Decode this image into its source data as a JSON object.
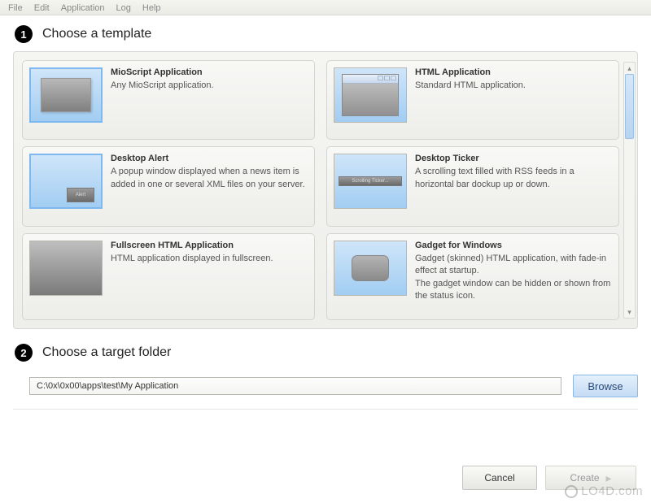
{
  "menu": {
    "items": [
      "File",
      "Edit",
      "Application",
      "Log",
      "Help"
    ]
  },
  "steps": {
    "template": {
      "num": "1",
      "title": "Choose a template"
    },
    "folder": {
      "num": "2",
      "title": "Choose a target folder"
    }
  },
  "templates": [
    {
      "title": "MioScript Application",
      "desc": "Any MioScript application.",
      "thumb": "mioscript",
      "selected": true
    },
    {
      "title": "HTML Application",
      "desc": "Standard HTML application.",
      "thumb": "html"
    },
    {
      "title": "Desktop Alert",
      "desc": "A popup window displayed when a news item is added in one or several XML files on your server.",
      "thumb": "alert",
      "alert_label": "Alert"
    },
    {
      "title": "Desktop Ticker",
      "desc": "A scrolling text filled with RSS feeds in a horizontal bar dockup up or down.",
      "thumb": "ticker",
      "ticker_label": "Scrolling Ticker..."
    },
    {
      "title": "Fullscreen HTML Application",
      "desc": "HTML application displayed in fullscreen.",
      "thumb": "fullscreen"
    },
    {
      "title": "Gadget for Windows",
      "desc": "Gadget (skinned) HTML application, with fade-in effect at startup.\nThe gadget window can be hidden or shown from the status icon.",
      "thumb": "gadget"
    }
  ],
  "folder": {
    "path": "C:\\0x\\0x00\\apps\\test\\My Application"
  },
  "buttons": {
    "browse": "Browse",
    "cancel": "Cancel",
    "create": "Create"
  },
  "watermark": "LO4D.com"
}
